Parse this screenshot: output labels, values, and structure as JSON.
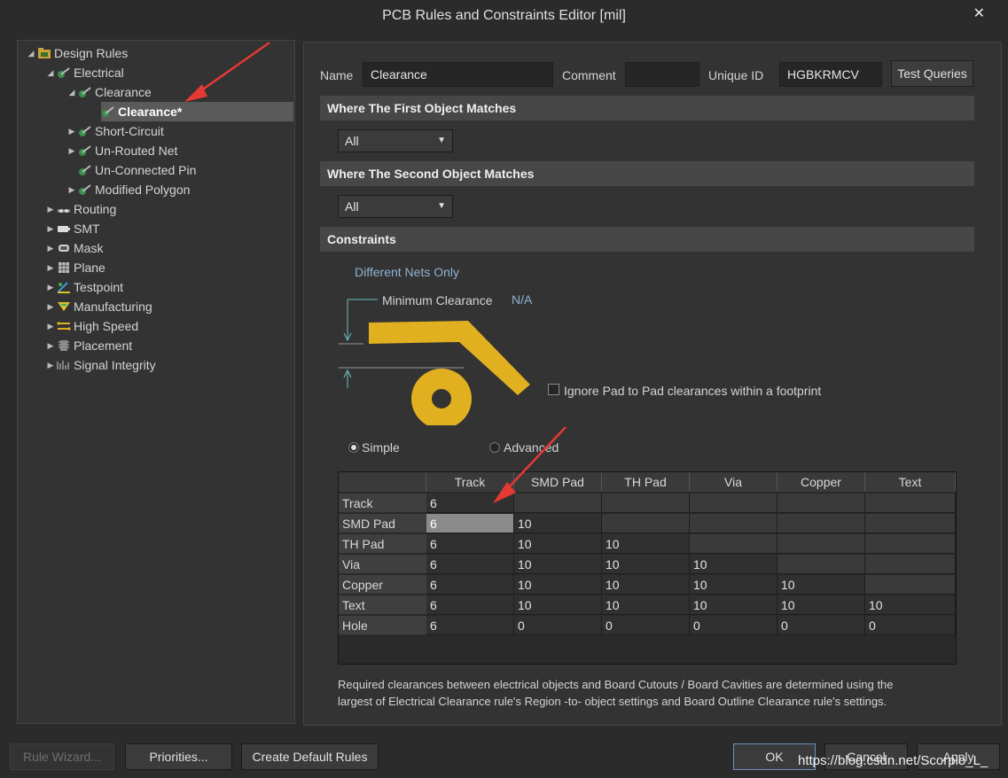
{
  "window": {
    "title": "PCB Rules and Constraints Editor [mil]",
    "close_glyph": "✕"
  },
  "tree": {
    "root": "Design Rules",
    "items": [
      {
        "label": "Electrical",
        "icon": "electrical-rule-icon"
      },
      {
        "label": "Clearance",
        "icon": "clearance-rule-icon"
      },
      {
        "label": "Clearance*",
        "icon": "clearance-rule-icon"
      },
      {
        "label": "Short-Circuit",
        "icon": "electrical-rule-icon"
      },
      {
        "label": "Un-Routed Net",
        "icon": "electrical-rule-icon"
      },
      {
        "label": "Un-Connected Pin",
        "icon": "electrical-rule-icon"
      },
      {
        "label": "Modified Polygon",
        "icon": "electrical-rule-icon"
      },
      {
        "label": "Routing",
        "icon": "routing-icon"
      },
      {
        "label": "SMT",
        "icon": "smt-icon"
      },
      {
        "label": "Mask",
        "icon": "mask-icon"
      },
      {
        "label": "Plane",
        "icon": "plane-icon"
      },
      {
        "label": "Testpoint",
        "icon": "testpoint-icon"
      },
      {
        "label": "Manufacturing",
        "icon": "manufacturing-icon"
      },
      {
        "label": "High Speed",
        "icon": "high-speed-icon"
      },
      {
        "label": "Placement",
        "icon": "placement-icon"
      },
      {
        "label": "Signal Integrity",
        "icon": "signal-integrity-icon"
      }
    ]
  },
  "rule": {
    "name_label": "Name",
    "name_value": "Clearance",
    "comment_label": "Comment",
    "comment_value": "",
    "uid_label": "Unique ID",
    "uid_value": "HGBKRMCV",
    "test_queries": "Test Queries"
  },
  "first_match": {
    "header": "Where The First Object Matches",
    "value": "All"
  },
  "second_match": {
    "header": "Where The Second Object Matches",
    "value": "All"
  },
  "constraints": {
    "header": "Constraints",
    "net_scope": "Different Nets Only",
    "min_clearance_label": "Minimum Clearance",
    "min_clearance_value": "N/A",
    "ignore_pad_label": "Ignore Pad to Pad clearances within a footprint",
    "ignore_pad_checked": false,
    "mode_simple": "Simple",
    "mode_advanced": "Advanced",
    "selected_mode": "Simple",
    "pad_color": "#e0b020"
  },
  "grid": {
    "columns": [
      "Track",
      "SMD Pad",
      "TH Pad",
      "Via",
      "Copper",
      "Text"
    ],
    "rows": [
      {
        "label": "Track",
        "values": [
          "6"
        ]
      },
      {
        "label": "SMD Pad",
        "values": [
          "6",
          "10"
        ]
      },
      {
        "label": "TH Pad",
        "values": [
          "6",
          "10",
          "10"
        ]
      },
      {
        "label": "Via",
        "values": [
          "6",
          "10",
          "10",
          "10"
        ]
      },
      {
        "label": "Copper",
        "values": [
          "6",
          "10",
          "10",
          "10",
          "10"
        ]
      },
      {
        "label": "Text",
        "values": [
          "6",
          "10",
          "10",
          "10",
          "10",
          "10"
        ]
      },
      {
        "label": "Hole",
        "values": [
          "6",
          "0",
          "0",
          "0",
          "0",
          "0"
        ]
      }
    ],
    "selected_cell": "SMD Pad / Track"
  },
  "note": {
    "line1": "Required clearances between electrical objects and Board Cutouts / Board Cavities are determined using the",
    "line2": "largest of Electrical Clearance rule's Region -to- object settings and Board Outline Clearance rule's settings."
  },
  "footer": {
    "rule_wizard": "Rule Wizard...",
    "priorities": "Priorities...",
    "create_default": "Create Default Rules",
    "ok": "OK",
    "cancel": "Cancel",
    "apply": "Apply"
  },
  "watermark": "https://blog.csdn.net/Scorpio_L_",
  "colors": {
    "arrow_red": "#e53935",
    "accent_blue": "#8fb3d6"
  }
}
